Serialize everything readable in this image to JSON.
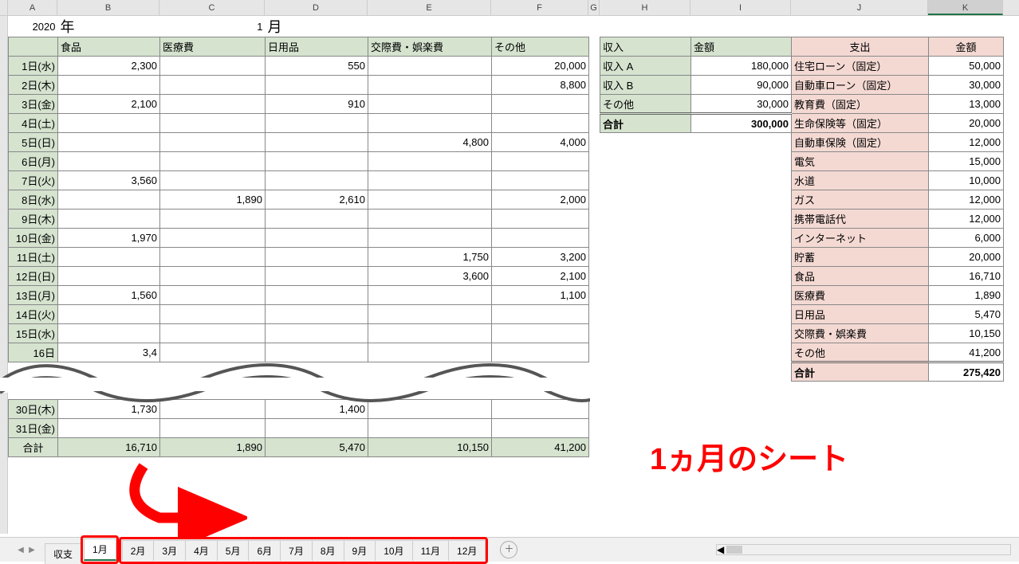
{
  "header": {
    "year": "2020",
    "year_suffix": "年",
    "month": "1",
    "month_suffix": "月"
  },
  "cols": [
    "A",
    "B",
    "C",
    "D",
    "E",
    "F",
    "G",
    "H",
    "I",
    "J",
    "K"
  ],
  "expense_headers": [
    "食品",
    "医療費",
    "日用品",
    "交際費・娯楽費",
    "その他"
  ],
  "daily": [
    {
      "d": "1日(水)",
      "v": [
        "2,300",
        "",
        "550",
        "",
        "20,000"
      ]
    },
    {
      "d": "2日(木)",
      "v": [
        "",
        "",
        "",
        "",
        "8,800"
      ]
    },
    {
      "d": "3日(金)",
      "v": [
        "2,100",
        "",
        "910",
        "",
        ""
      ]
    },
    {
      "d": "4日(土)",
      "v": [
        "",
        "",
        "",
        "",
        ""
      ]
    },
    {
      "d": "5日(日)",
      "v": [
        "",
        "",
        "",
        "4,800",
        "4,000"
      ]
    },
    {
      "d": "6日(月)",
      "v": [
        "",
        "",
        "",
        "",
        ""
      ]
    },
    {
      "d": "7日(火)",
      "v": [
        "3,560",
        "",
        "",
        "",
        ""
      ]
    },
    {
      "d": "8日(水)",
      "v": [
        "",
        "1,890",
        "2,610",
        "",
        "2,000"
      ]
    },
    {
      "d": "9日(木)",
      "v": [
        "",
        "",
        "",
        "",
        ""
      ]
    },
    {
      "d": "10日(金)",
      "v": [
        "1,970",
        "",
        "",
        "",
        ""
      ]
    },
    {
      "d": "11日(土)",
      "v": [
        "",
        "",
        "",
        "1,750",
        "3,200"
      ]
    },
    {
      "d": "12日(日)",
      "v": [
        "",
        "",
        "",
        "3,600",
        "2,100"
      ]
    },
    {
      "d": "13日(月)",
      "v": [
        "1,560",
        "",
        "",
        "",
        "1,100"
      ]
    },
    {
      "d": "14日(火)",
      "v": [
        "",
        "",
        "",
        "",
        ""
      ]
    },
    {
      "d": "15日(水)",
      "v": [
        "",
        "",
        "",
        "",
        ""
      ]
    },
    {
      "d": "16日",
      "v": [
        "3,4",
        "",
        "",
        "",
        ""
      ]
    }
  ],
  "daily2": [
    {
      "d": "30日(木)",
      "v": [
        "1,730",
        "",
        "1,400",
        "",
        ""
      ]
    },
    {
      "d": "31日(金)",
      "v": [
        "",
        "",
        "",
        "",
        ""
      ]
    }
  ],
  "totals": {
    "label": "合計",
    "v": [
      "16,710",
      "1,890",
      "5,470",
      "10,150",
      "41,200"
    ]
  },
  "income": {
    "hdr": [
      "収入",
      "金額"
    ],
    "rows": [
      [
        "収入 A",
        "180,000"
      ],
      [
        "収入 B",
        "90,000"
      ],
      [
        "その他",
        "30,000"
      ]
    ],
    "total": [
      "合計",
      "300,000"
    ]
  },
  "outgo": {
    "hdr": [
      "支出",
      "金額"
    ],
    "rows": [
      [
        "住宅ローン（固定）",
        "50,000"
      ],
      [
        "自動車ローン（固定）",
        "30,000"
      ],
      [
        "教育費（固定）",
        "13,000"
      ],
      [
        "生命保険等（固定）",
        "20,000"
      ],
      [
        "自動車保険（固定）",
        "12,000"
      ],
      [
        "電気",
        "15,000"
      ],
      [
        "水道",
        "10,000"
      ],
      [
        "ガス",
        "12,000"
      ],
      [
        "携帯電話代",
        "12,000"
      ],
      [
        "インターネット",
        "6,000"
      ],
      [
        "貯蓄",
        "20,000"
      ],
      [
        "食品",
        "16,710"
      ],
      [
        "医療費",
        "1,890"
      ],
      [
        "日用品",
        "5,470"
      ],
      [
        "交際費・娯楽費",
        "10,150"
      ],
      [
        "その他",
        "41,200"
      ]
    ],
    "total": [
      "合計",
      "275,420"
    ]
  },
  "tabs": [
    "収支",
    "1月",
    "2月",
    "3月",
    "4月",
    "5月",
    "6月",
    "7月",
    "8月",
    "9月",
    "10月",
    "11月",
    "12月"
  ],
  "active_tab": "1月",
  "annotation": "1ヵ月のシート"
}
